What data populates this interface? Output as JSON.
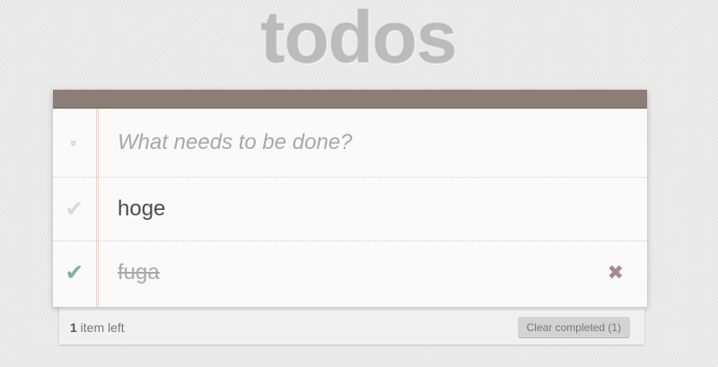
{
  "app": {
    "title": "todos"
  },
  "new_todo": {
    "placeholder": "What needs to be done?",
    "value": ""
  },
  "toggle_all": {
    "icon": "double-chevron-down-icon",
    "glyph": "»"
  },
  "todos": [
    {
      "label": "hoge",
      "completed": false,
      "check_glyph": "✔"
    },
    {
      "label": "fuga",
      "completed": true,
      "check_glyph": "✔",
      "destroy_glyph": "✖"
    }
  ],
  "footer": {
    "count": "1",
    "count_suffix": " item left",
    "clear_label": "Clear completed (1)"
  },
  "colors": {
    "header_bar": "#8d7d77",
    "checked": "#85ada7",
    "unchecked": "#d9d9d9",
    "destroy": "#a88a8a",
    "margin_line": "#f1cfcc"
  }
}
